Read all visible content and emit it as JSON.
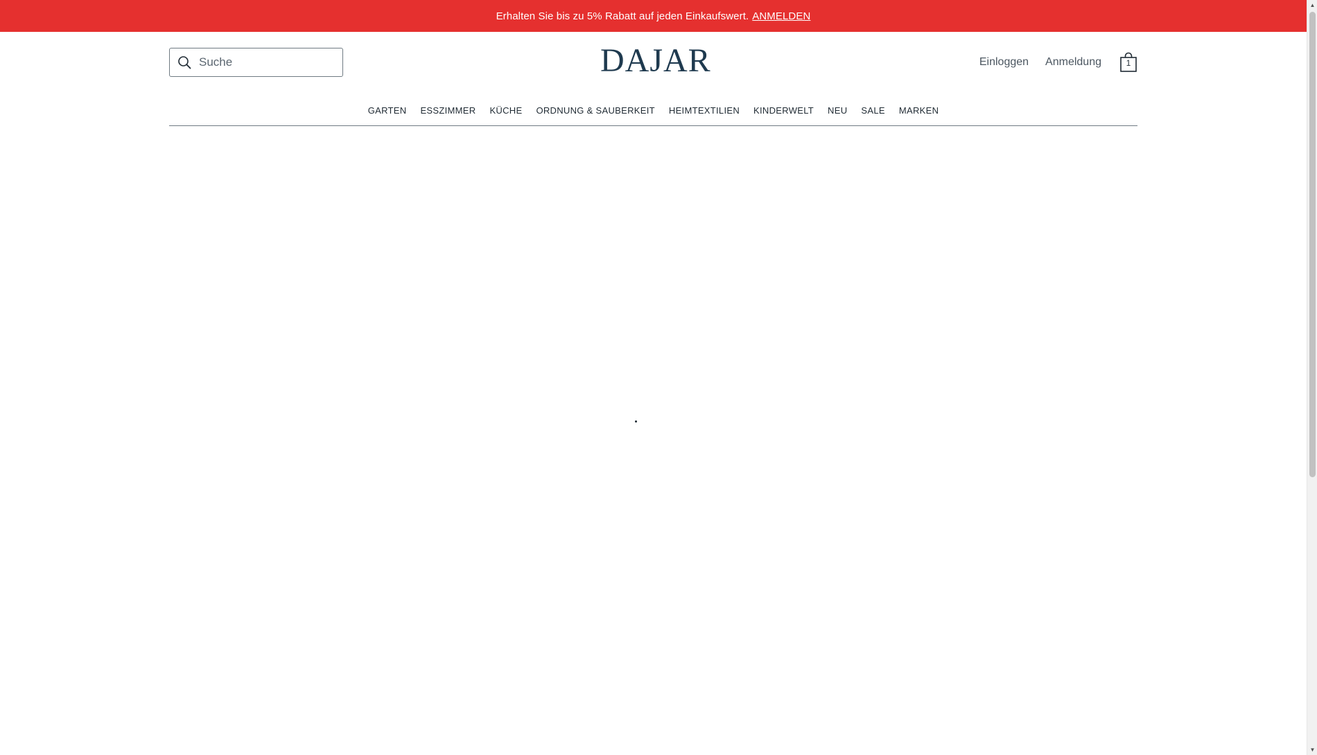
{
  "promo": {
    "text": "Erhalten Sie bis zu 5% Rabatt auf jeden Einkaufswert.",
    "link_label": "ANMELDEN",
    "background_color": "#e5302f"
  },
  "header": {
    "search": {
      "placeholder": "Suche",
      "value": "",
      "icon": "search-icon"
    },
    "logo_text": "DAJAR",
    "logo_color": "#1f3a4f",
    "login_label": "Einloggen",
    "register_label": "Anmeldung",
    "cart": {
      "icon": "shopping-bag-icon",
      "count": "1"
    }
  },
  "nav": {
    "items": [
      {
        "label": "GARTEN"
      },
      {
        "label": "ESSZIMMER"
      },
      {
        "label": "KÜCHE"
      },
      {
        "label": "ORDNUNG & SAUBERKEIT"
      },
      {
        "label": "HEIMTEXTILIEN"
      },
      {
        "label": "KINDERWELT"
      },
      {
        "label": "NEU"
      },
      {
        "label": "SALE"
      },
      {
        "label": "MARKEN"
      }
    ]
  }
}
